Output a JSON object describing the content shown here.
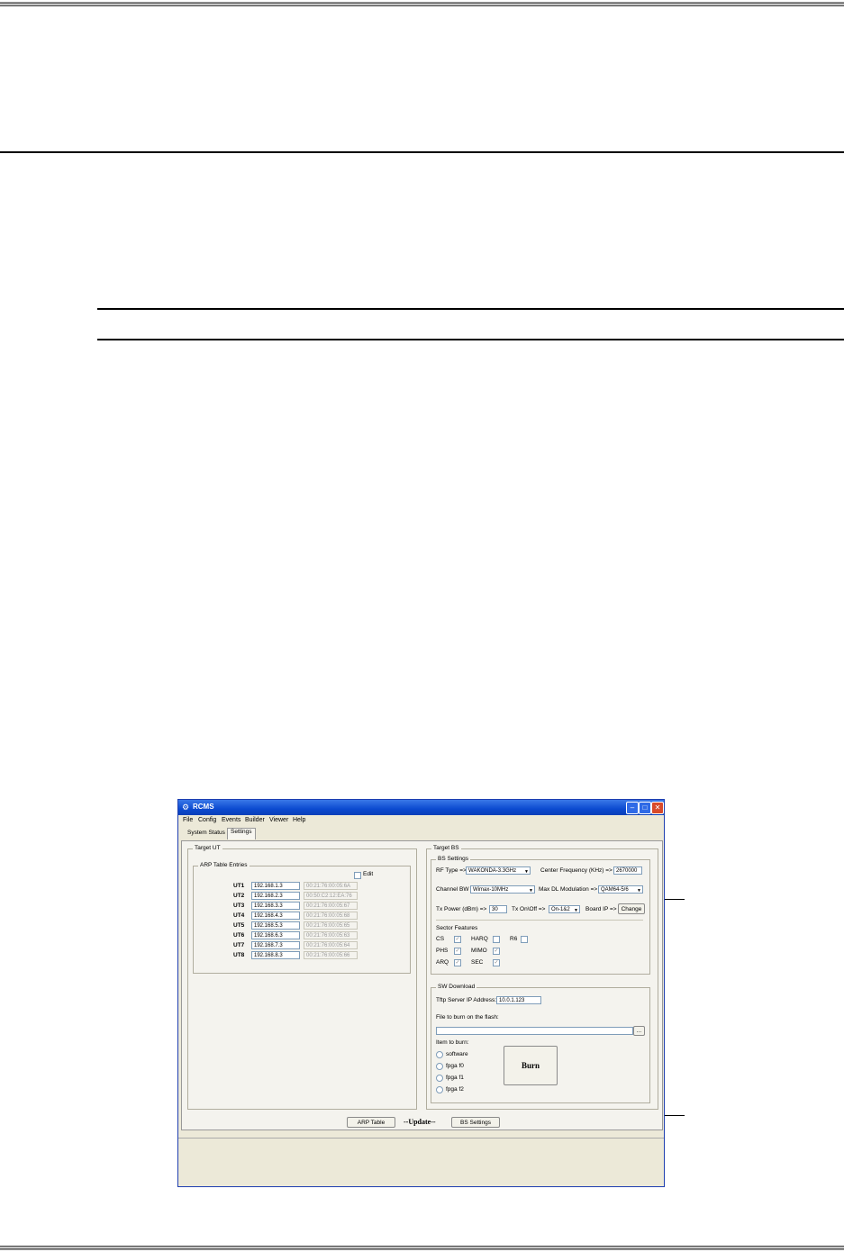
{
  "window": {
    "title": "RCMS",
    "menu": [
      "File",
      "Config",
      "Events",
      "Builder",
      "Viewer",
      "Help"
    ],
    "tabs": [
      "System Status",
      "Settings"
    ]
  },
  "target_ut": {
    "label": "Target UT",
    "arp_label": "ARP Table Entries",
    "edit_label": "Edit",
    "rows": [
      {
        "ut": "UT1",
        "ip": "192.168.1.3",
        "mac": "00:21:76:00:05:6A"
      },
      {
        "ut": "UT2",
        "ip": "192.168.2.3",
        "mac": "00:50:C2:12:EA:76"
      },
      {
        "ut": "UT3",
        "ip": "192.168.3.3",
        "mac": "00:21:76:00:05:67"
      },
      {
        "ut": "UT4",
        "ip": "192.168.4.3",
        "mac": "00:21:76:00:05:68"
      },
      {
        "ut": "UT5",
        "ip": "192.168.5.3",
        "mac": "00:21:76:00:05:65"
      },
      {
        "ut": "UT6",
        "ip": "192.168.6.3",
        "mac": "00:21:76:00:05:63"
      },
      {
        "ut": "UT7",
        "ip": "192.168.7.3",
        "mac": "00:21:76:00:05:64"
      },
      {
        "ut": "UT8",
        "ip": "192.168.8.3",
        "mac": "00:21:76:00:05:66"
      }
    ]
  },
  "target_bs": {
    "label": "Target BS",
    "bs_settings_label": "BS Settings",
    "rf_type_label": "RF Type =>",
    "rf_type_value": "WAKONDA-3.3GHz",
    "center_freq_label": "Center Frequency (KHz) =>",
    "center_freq_value": "2670000",
    "channel_bw_label": "Channel BW =>",
    "channel_bw_value": "Wimax-10MHz",
    "max_dl_label": "Max DL Modulation =>",
    "max_dl_value": "QAM64-5/6",
    "tx_power_label": "Tx Power (dBm) =>",
    "tx_power_value": "30",
    "tx_onoff_label": "Tx On\\Off =>",
    "tx_onoff_value": "On-1&2",
    "board_ip_label": "Board IP =>",
    "change_label": "Change",
    "sector_features_label": "Sector Features",
    "features": [
      "CS",
      "HARQ",
      "R6",
      "PHS",
      "MIMO",
      "ARQ",
      "SEC"
    ]
  },
  "sw_download": {
    "label": "SW Download",
    "tftp_label": "Tftp Server IP Address:",
    "tftp_value": "10.0.1.123",
    "file_label": "File to burn on the flash:",
    "browse_label": "...",
    "item_label": "Item to burn:",
    "items": [
      "software",
      "fpga f0",
      "fpga f1",
      "fpga f2"
    ],
    "burn_label": "Burn"
  },
  "bottom": {
    "arp_button": "ARP Table",
    "update_label": "--Update--",
    "bs_button": "BS Settings"
  }
}
